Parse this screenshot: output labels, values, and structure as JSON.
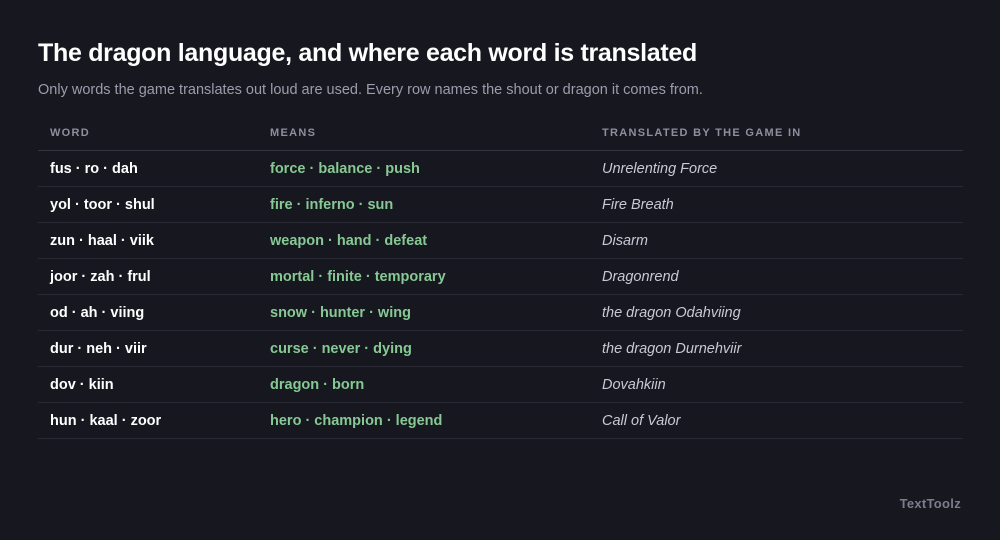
{
  "header": {
    "title": "The dragon language, and where each word is translated",
    "subtitle": "Only words the game translates out loud are used. Every row names the shout or dragon it comes from."
  },
  "table": {
    "columns": [
      "WORD",
      "MEANS",
      "TRANSLATED BY THE GAME IN"
    ],
    "rows": [
      {
        "word": "fus · ro · dah",
        "means": "force · balance · push",
        "source": "Unrelenting Force"
      },
      {
        "word": "yol · toor · shul",
        "means": "fire · inferno · sun",
        "source": "Fire Breath"
      },
      {
        "word": "zun · haal · viik",
        "means": "weapon · hand · defeat",
        "source": "Disarm"
      },
      {
        "word": "joor · zah · frul",
        "means": "mortal · finite · temporary",
        "source": "Dragonrend"
      },
      {
        "word": "od · ah · viing",
        "means": "snow · hunter · wing",
        "source": "the dragon Odahviing"
      },
      {
        "word": "dur · neh · viir",
        "means": "curse · never · dying",
        "source": "the dragon Durnehviir"
      },
      {
        "word": "dov · kiin",
        "means": "dragon · born",
        "source": "Dovahkiin"
      },
      {
        "word": "hun · kaal · zoor",
        "means": "hero · champion · legend",
        "source": "Call of Valor"
      }
    ]
  },
  "footer": {
    "brand": "TextToolz"
  },
  "colors": {
    "background": "#17171f",
    "means_accent": "#86c994",
    "muted": "#9c9cad"
  }
}
